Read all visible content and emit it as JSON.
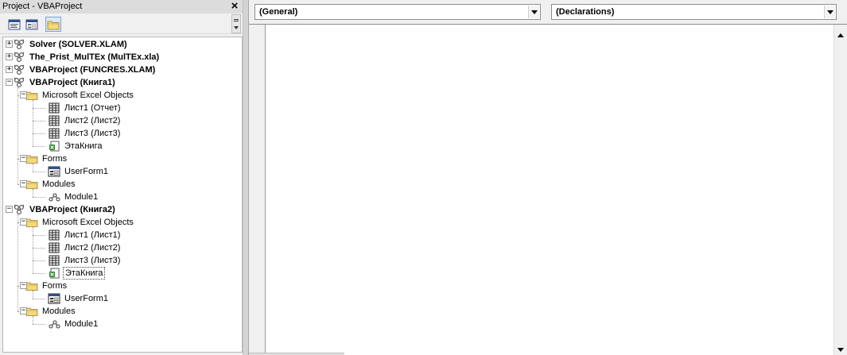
{
  "project_panel": {
    "title": "Project - VBAProject",
    "close_glyph": "×",
    "toolbar": {
      "buttons": [
        {
          "icon": "view-code-icon"
        },
        {
          "icon": "view-object-icon"
        },
        {
          "icon": "toggle-folders-icon",
          "active": true
        }
      ]
    },
    "tree": [
      {
        "label": "Solver (SOLVER.XLAM)",
        "kind": "project",
        "expander": "+"
      },
      {
        "label": "The_Prist_MulTEx (MulTEx.xla)",
        "kind": "project",
        "expander": "+"
      },
      {
        "label": "VBAProject (FUNCRES.XLAM)",
        "kind": "project",
        "expander": "+"
      },
      {
        "label": "VBAProject (Книга1)",
        "kind": "project",
        "expander": "−"
      },
      {
        "label": "Microsoft Excel Objects",
        "kind": "folder",
        "expander": "−"
      },
      {
        "label": "Лист1 (Отчет)",
        "kind": "sheet"
      },
      {
        "label": "Лист2 (Лист2)",
        "kind": "sheet"
      },
      {
        "label": "Лист3 (Лист3)",
        "kind": "sheet"
      },
      {
        "label": "ЭтаКнига",
        "kind": "workbook"
      },
      {
        "label": "Forms",
        "kind": "folder",
        "expander": "−"
      },
      {
        "label": "UserForm1",
        "kind": "form"
      },
      {
        "label": "Modules",
        "kind": "folder",
        "expander": "−"
      },
      {
        "label": "Module1",
        "kind": "module"
      },
      {
        "label": "VBAProject (Книга2)",
        "kind": "project",
        "expander": "−"
      },
      {
        "label": "Microsoft Excel Objects",
        "kind": "folder",
        "expander": "−"
      },
      {
        "label": "Лист1 (Лист1)",
        "kind": "sheet"
      },
      {
        "label": "Лист2 (Лист2)",
        "kind": "sheet"
      },
      {
        "label": "Лист3 (Лист3)",
        "kind": "sheet"
      },
      {
        "label": "ЭтаКнига",
        "kind": "workbook",
        "selected": true
      },
      {
        "label": "Forms",
        "kind": "folder",
        "expander": "−"
      },
      {
        "label": "UserForm1",
        "kind": "form"
      },
      {
        "label": "Modules",
        "kind": "folder",
        "expander": "−"
      },
      {
        "label": "Module1",
        "kind": "module"
      }
    ]
  },
  "code_window": {
    "object_combo": {
      "value": "(General)"
    },
    "procedure_combo": {
      "value": "(Declarations)"
    }
  },
  "colors": {
    "panel_bg": "#f0f0f0",
    "tree_bg": "#ffffff",
    "folder_yellow": "#f3d97a",
    "workbook_green": "#2e8b2e",
    "selection_border": "#444444"
  }
}
